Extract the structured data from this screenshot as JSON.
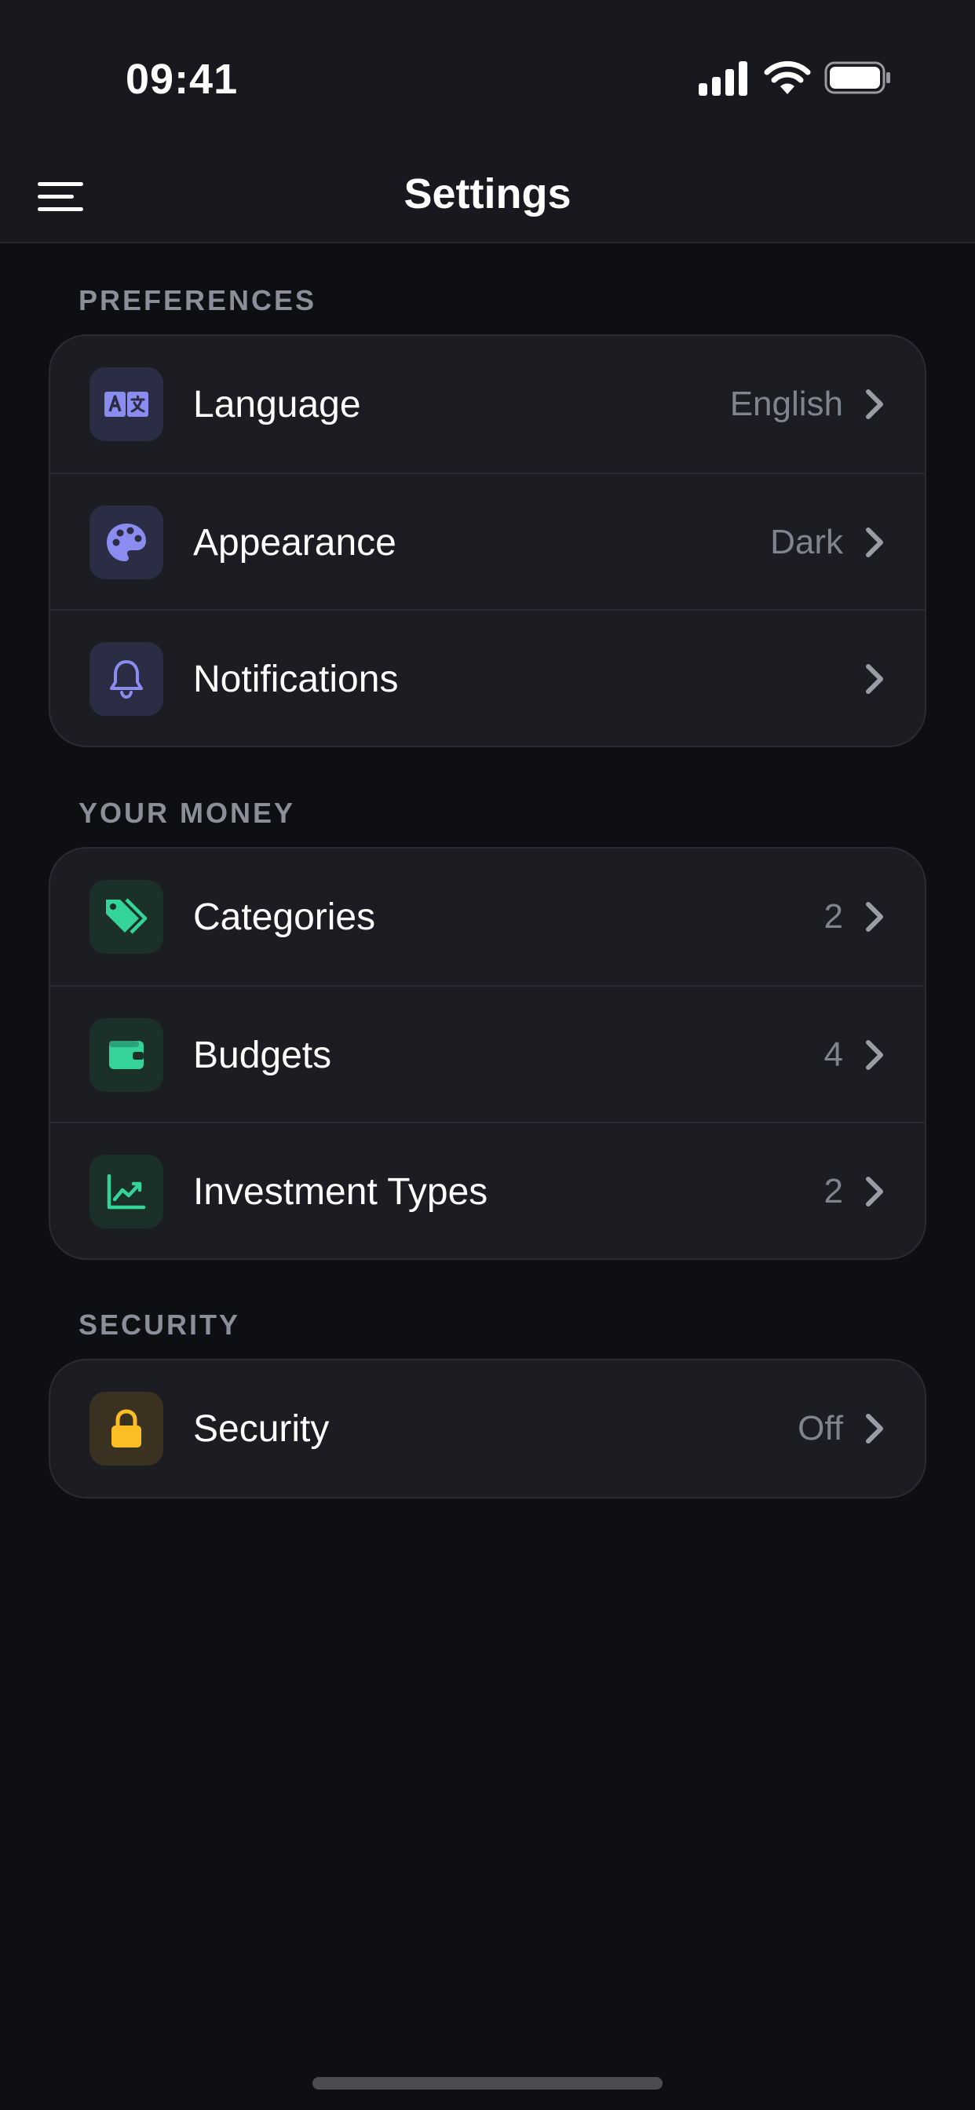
{
  "status_bar": {
    "time": "09:41"
  },
  "nav": {
    "title": "Settings"
  },
  "sections": [
    {
      "label": "PREFERENCES",
      "items": [
        {
          "label": "Language",
          "value": "English",
          "icon": "translate-icon"
        },
        {
          "label": "Appearance",
          "value": "Dark",
          "icon": "palette-icon"
        },
        {
          "label": "Notifications",
          "value": "",
          "icon": "bell-icon"
        }
      ]
    },
    {
      "label": "YOUR MONEY",
      "items": [
        {
          "label": "Categories",
          "value": "2",
          "icon": "tag-icon"
        },
        {
          "label": "Budgets",
          "value": "4",
          "icon": "wallet-icon"
        },
        {
          "label": "Investment Types",
          "value": "2",
          "icon": "chart-icon"
        }
      ]
    },
    {
      "label": "SECURITY",
      "items": [
        {
          "label": "Security",
          "value": "Off",
          "icon": "lock-icon"
        }
      ]
    }
  ],
  "colors": {
    "accent_purple": "#8b8cf0",
    "accent_green": "#34d399",
    "accent_amber": "#fbbf24",
    "background": "#0e0f13",
    "card": "#1c1d22"
  }
}
